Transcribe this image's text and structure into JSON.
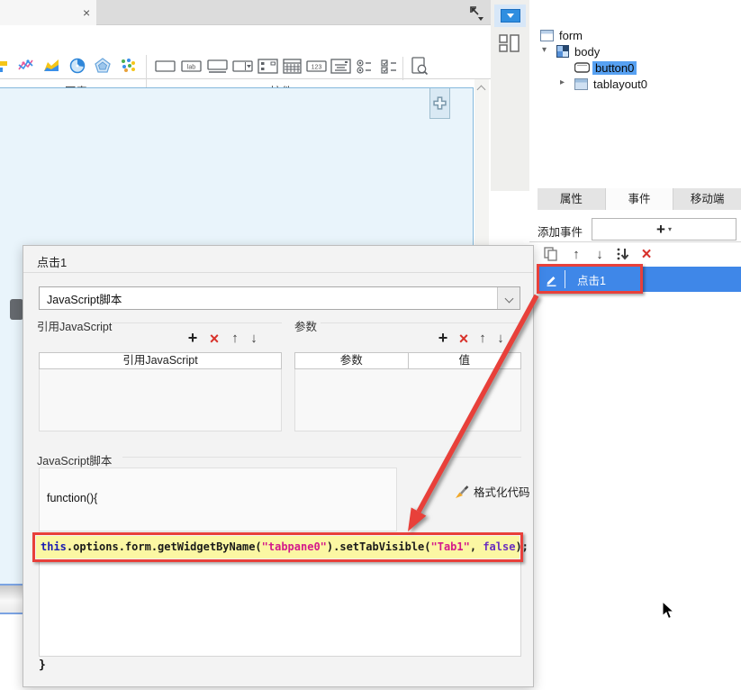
{
  "window": {
    "tab_close": "×"
  },
  "toolbar": {
    "chart_group_label": "图表",
    "controls_group_label": "控件",
    "label_widget_glyph": "lab",
    "number_widget_glyph": "123"
  },
  "glyphs": {
    "plus": "+",
    "delete": "×",
    "up": "↑",
    "down": "↓",
    "dropdown_small": "▾",
    "tree_expanded": "▾",
    "tree_collapsed": "▸"
  },
  "widget_tree": {
    "items": [
      {
        "label": "form"
      },
      {
        "label": "body"
      },
      {
        "label": "button0"
      },
      {
        "label": "tablayout0"
      }
    ]
  },
  "right_panel": {
    "tabs": [
      {
        "label": "属性"
      },
      {
        "label": "事件"
      },
      {
        "label": "移动端"
      }
    ],
    "add_event_label": "添加事件",
    "event_item_label": "点击1"
  },
  "dialog": {
    "title": "点击1",
    "event_type_value": "JavaScript脚本",
    "ref_js_group": {
      "label": "引用JavaScript",
      "column_header": "引用JavaScript"
    },
    "param_group": {
      "label": "参数",
      "param_column": "参数",
      "value_column": "值"
    },
    "script_group": {
      "label": "JavaScript脚本",
      "function_open": "function(){",
      "function_close": "}",
      "format_button": "格式化代码",
      "code": {
        "kw_this": "this",
        "chain_1": ".options.form.getWidgetByName(",
        "string_1": "\"tabpane0\"",
        "chain_2": ").setTabVisible(",
        "string_2": "\"Tab1\"",
        "comma": ", ",
        "literal_false": "false",
        "end": ");"
      }
    }
  },
  "colors": {
    "annotation_red": "#e8403a",
    "selection_blue": "#3f87e8",
    "tree_selection_blue": "#57a1f2",
    "code_highlight": "#fbf7a3",
    "code_keyword": "#1b1bb3",
    "code_string": "#d41a8a",
    "code_literal": "#6a2fbf"
  }
}
